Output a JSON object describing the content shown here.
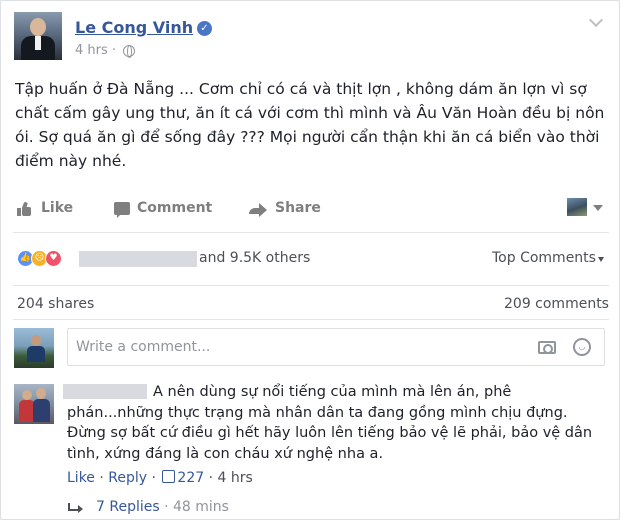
{
  "post": {
    "author": "Le Cong Vinh",
    "time": "4 hrs",
    "meta_separator": "·",
    "text": "Tập huấn ở Đà Nẵng ... Cơm chỉ có cá và thịt lợn , không dám ăn lợn vì sợ chất cấm gây ung thư, ăn ít cá với cơm thì mình và Âu Văn Hoàn đều bị nôn ói. Sợ quá ăn gì để sống đây ??? Mọi người cẩn thận khi ăn cá biển vào thời điểm này nhé."
  },
  "actions": {
    "like": "Like",
    "comment": "Comment",
    "share": "Share"
  },
  "reactions": {
    "others": "and 9.5K others",
    "sort_label": "Top Comments",
    "shares": "204 shares",
    "comments": "209 comments"
  },
  "composer": {
    "placeholder": "Write a comment..."
  },
  "comment": {
    "text": "A nên dùng sự nổi tiếng của mình mà lên án, phê phán...những thực trạng mà nhân dân ta đang gồng mình chịu đựng. Đừng sợ bất cứ điều gì hết hãy luôn lên tiếng bảo vệ lẽ phải, bảo vệ dân tình, xứng đáng là con cháu xứ nghệ nha a.",
    "like": "Like",
    "reply": "Reply",
    "separator": "·",
    "like_count": "227",
    "time": "4 hrs",
    "replies": "7 Replies",
    "replies_time": "48 mins"
  },
  "icons": {
    "verified": "verified-check-icon",
    "audience": "globe-icon",
    "like": "thumbs-up-icon",
    "comment": "speech-bubble-icon",
    "share": "share-arrow-icon",
    "camera": "camera-icon",
    "emoji": "smiley-icon",
    "reply": "reply-arrow-icon"
  },
  "colors": {
    "link": "#365899",
    "text": "#1d2129",
    "muted": "#90949c",
    "reaction_like": "#5890ff",
    "reaction_sad": "#f7b125",
    "reaction_love": "#f25268"
  }
}
